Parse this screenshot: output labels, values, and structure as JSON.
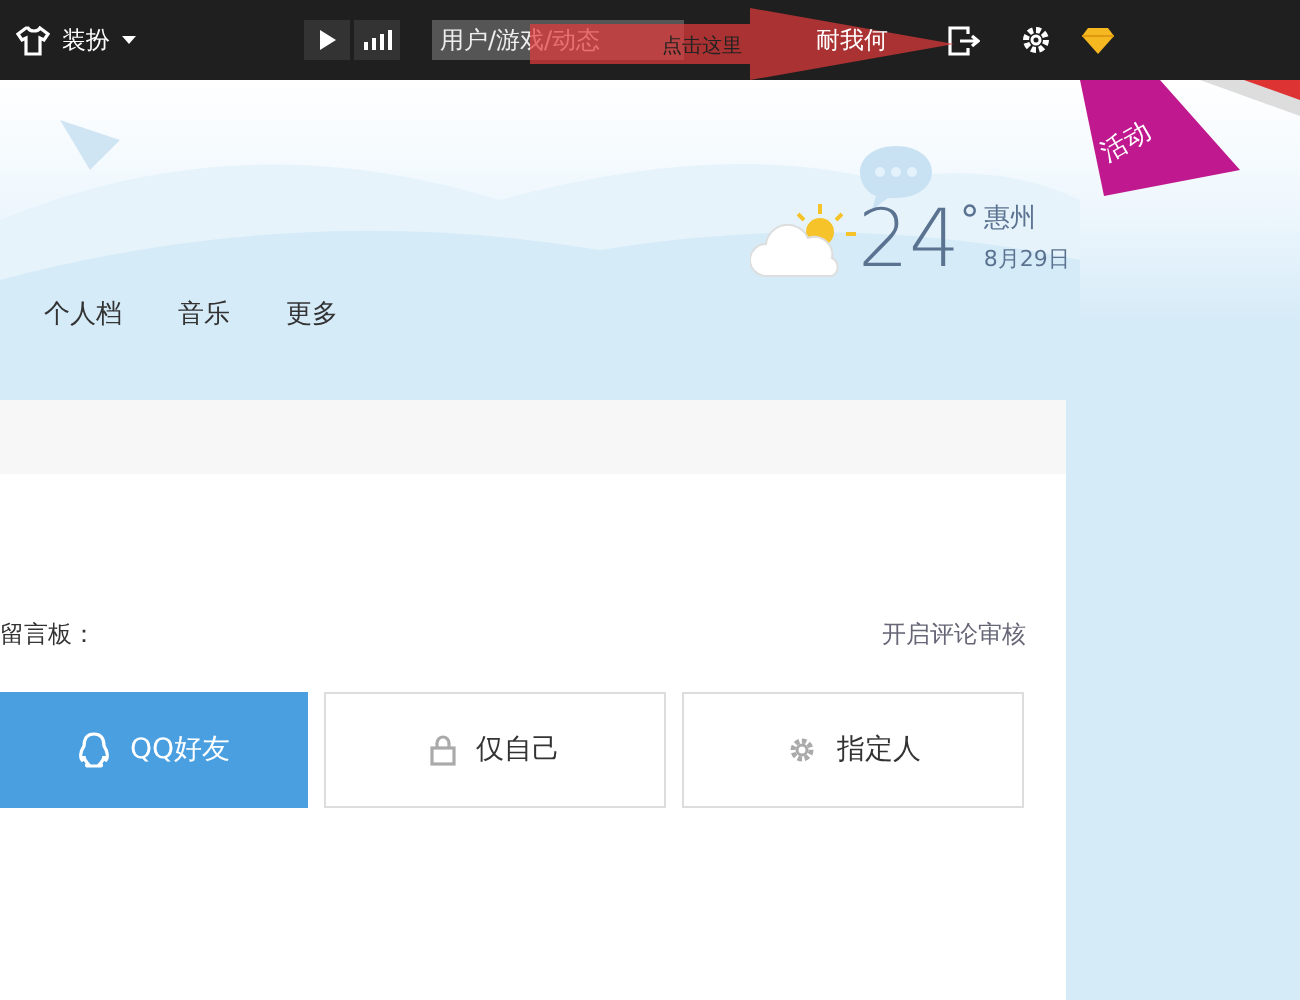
{
  "topbar": {
    "theme_label": "装扮",
    "search": {
      "placeholder": "用户/游戏/动态"
    },
    "link": "耐我何"
  },
  "annotation": {
    "label": "点击这里"
  },
  "ribbon": {
    "label": "活动"
  },
  "weather": {
    "temperature": "24",
    "degree": "°",
    "city": "惠州",
    "date": "8月29日"
  },
  "nav": [
    {
      "label": "个人档"
    },
    {
      "label": "音乐"
    },
    {
      "label": "更多"
    }
  ],
  "board": {
    "label": "留言板：",
    "review_link": "开启评论审核",
    "options": [
      {
        "label": "QQ好友",
        "kind": "qq",
        "selected": true
      },
      {
        "label": "仅自己",
        "kind": "lock",
        "selected": false
      },
      {
        "label": "指定人",
        "kind": "gear",
        "selected": false
      }
    ]
  }
}
